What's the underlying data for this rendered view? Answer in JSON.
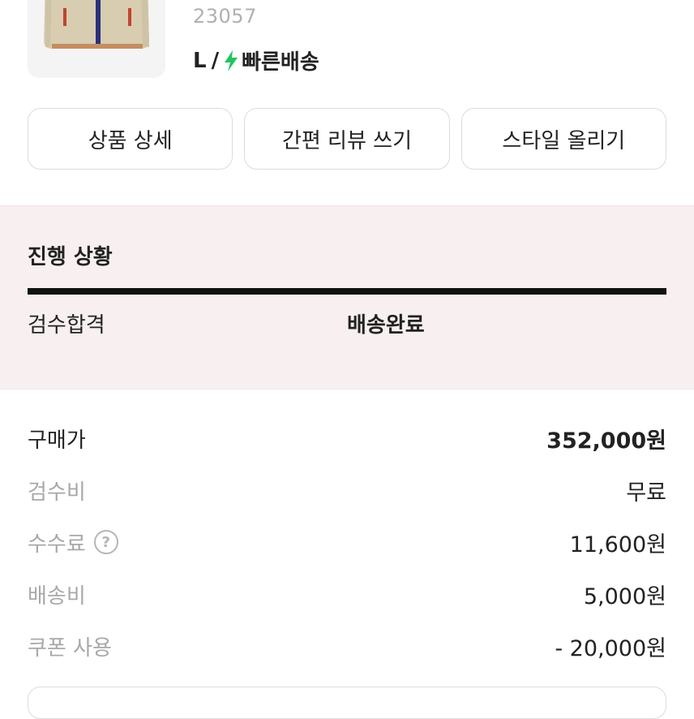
{
  "product": {
    "model_number": "23057",
    "size": "L",
    "separator": "/",
    "delivery_label": "빠른배송",
    "delivery_icon": "lightning-bolt-icon",
    "accent_green": "#22c45e"
  },
  "actions": {
    "detail_label": "상품 상세",
    "review_label": "간편 리뷰 쓰기",
    "style_label": "스타일 올리기"
  },
  "progress": {
    "title": "진행 상황",
    "steps": [
      "검수합격",
      "배송완료"
    ],
    "current_step": "배송완료",
    "background": "#f8f0f0"
  },
  "prices": [
    {
      "label": "구매가",
      "value": "352,000원",
      "primary": true
    },
    {
      "label": "검수비",
      "value": "무료"
    },
    {
      "label": "수수료",
      "value": "11,600원",
      "help_icon": "question-circle-icon"
    },
    {
      "label": "배송비",
      "value": "5,000원"
    },
    {
      "label": "쿠폰 사용",
      "value": "- 20,000원"
    }
  ]
}
